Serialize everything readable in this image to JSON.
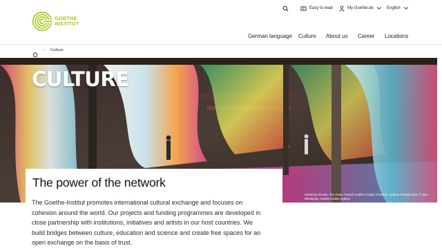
{
  "brand": {
    "logo_text": "GOETHE\nINSTITUT",
    "accent": "#a0c814"
  },
  "utility_nav": {
    "search_icon": "search-icon",
    "easy_to_read": {
      "label": "Easy to read",
      "icon": "easy-read-icon"
    },
    "my_goethe": {
      "label": "My Goethe.de",
      "icon": "user-icon"
    },
    "language": {
      "label": "English"
    }
  },
  "main_nav": [
    {
      "label": "German language"
    },
    {
      "label": "Culture"
    },
    {
      "label": "About us"
    },
    {
      "label": "Career"
    },
    {
      "label": "Locations"
    }
  ],
  "breadcrumb": {
    "home_icon": "home-icon",
    "separator": "›",
    "current": "Culture"
  },
  "hero": {
    "title": "CULTURE",
    "caption": "Katharina Grosse, The Horse Trotted Another Couple of Metres, Sydney Festival 2018. © Zan Wimberley, Goethe-Institut Sydney"
  },
  "section": {
    "title": "The power of the network",
    "body": "The Goethe-Institut promotes international cultural exchange and focuses on cohesion around the world. Our projects and funding programmes are developed in close partnership with institutions, initiatives and artists in our host countries. We build bridges between culture, education and science and create free spaces for an open exchange on the basis of trust."
  }
}
